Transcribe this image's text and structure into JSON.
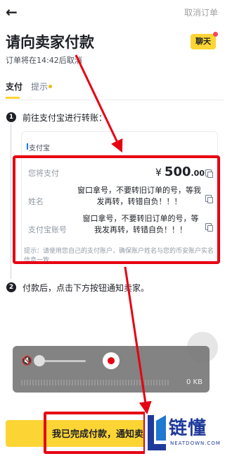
{
  "header": {
    "back_icon": "arrow-left-icon",
    "cancel_label": "取消订单"
  },
  "page": {
    "title": "请向卖家付款",
    "subtitle": "订单将在14:42后取消",
    "chat_label": "聊天"
  },
  "tabs": [
    {
      "label": "支付",
      "active": true
    },
    {
      "label": "提示",
      "active": false
    }
  ],
  "steps": [
    {
      "num": "1",
      "text": "前往支付宝进行转账："
    },
    {
      "num": "2",
      "text": "付款后，点击下方按钮通知卖家。"
    }
  ],
  "payment": {
    "method": "支付宝",
    "amount_label": "您将支付",
    "currency": "¥",
    "amount_int": "500",
    "amount_dec": ".00",
    "name_label": "姓名",
    "name_value": "窗口拿号，不要转旧订单的号，等我发再转，转错自负！！！",
    "account_label": "支付宝账号",
    "account_value": "窗口拿号，不要转旧订单的号，等我发再转，转错自负！！！",
    "hint": "提示：请使用您自己的支付账户，确保账户姓名与您的币安账户实名信息一致"
  },
  "recorder": {
    "size": "0 KB"
  },
  "footer": {
    "confirm_label": "我已完成付款，通知卖家"
  },
  "watermark": {
    "text": "链懂",
    "sub": "NEATDOWN.COM"
  },
  "colors": {
    "brand_yellow": "#fcd535",
    "annotation_red": "#e60012",
    "text_primary": "#1e2026"
  }
}
